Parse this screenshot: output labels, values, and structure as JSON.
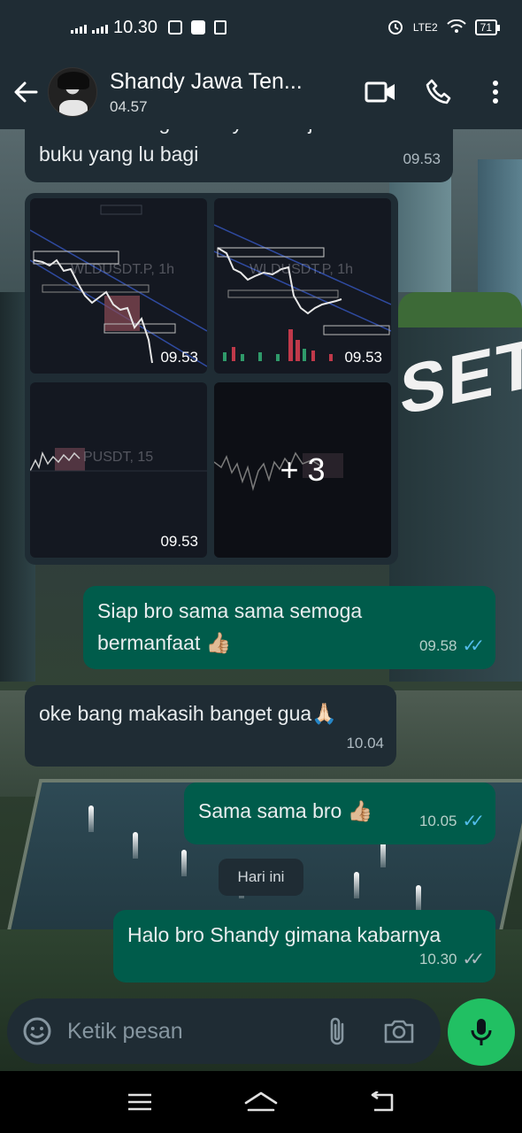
{
  "status_bar": {
    "time": "10.30",
    "network_label": "LTE2",
    "battery": "71"
  },
  "header": {
    "contact_name": "Shandy Jawa Ten...",
    "contact_status": "04.57"
  },
  "messages": {
    "m1": {
      "text_line1": "alhamdulilah gua banyak belajar dari",
      "text_line2": "buku yang lu bagi",
      "time": "09.53"
    },
    "images": {
      "tiles": [
        {
          "label": "WLDUSDT.P, 1h",
          "time": "09.53"
        },
        {
          "label": "WLDUSDT.P, 1h",
          "time": "09.53"
        },
        {
          "label": "PUSDT, 15",
          "time": "09.53"
        },
        {
          "label": "",
          "time": "",
          "more": "+ 3"
        }
      ]
    },
    "m2": {
      "text_line1": "Siap bro sama sama semoga",
      "text_line2": "bermanfaat 👍🏼",
      "time": "09.58"
    },
    "m3": {
      "text": "oke bang makasih banget gua🙏🏻",
      "time": "10.04"
    },
    "m4": {
      "text": "Sama sama bro 👍🏼",
      "time": "10.05"
    },
    "date_divider": "Hari ini",
    "m5": {
      "text": "Halo bro Shandy gimana kabarnya",
      "time": "10.30"
    }
  },
  "composer": {
    "placeholder": "Ketik pesan"
  },
  "wallpaper": {
    "sign_text": "SET"
  },
  "colors": {
    "header_bg": "#1f2c34",
    "incoming_bubble": "#1f2c34",
    "outgoing_bubble": "#005c4b",
    "mic_button": "#21c063",
    "read_ticks": "#53bdeb"
  },
  "icons": {
    "back": "arrow-left-icon",
    "video": "video-camera-icon",
    "call": "phone-icon",
    "menu": "more-vertical-icon",
    "emoji": "emoji-icon",
    "attach": "paperclip-icon",
    "camera": "camera-icon",
    "mic": "microphone-icon"
  }
}
